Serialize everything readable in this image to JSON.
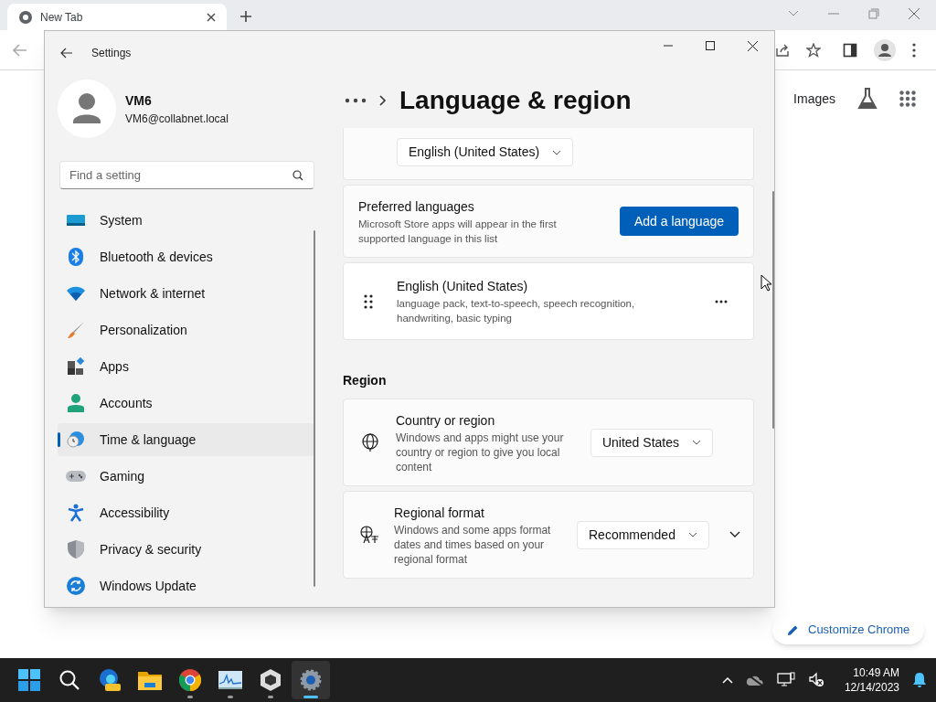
{
  "browser": {
    "tab": {
      "title": "New Tab"
    },
    "links": [
      "Images"
    ],
    "customize_button": "Customize Chrome"
  },
  "settings": {
    "title": "Settings",
    "user": {
      "name": "VM6",
      "email": "VM6@collabnet.local"
    },
    "search": {
      "placeholder": "Find a setting"
    },
    "nav": [
      {
        "label": "System",
        "selected": false
      },
      {
        "label": "Bluetooth & devices",
        "selected": false
      },
      {
        "label": "Network & internet",
        "selected": false
      },
      {
        "label": "Personalization",
        "selected": false
      },
      {
        "label": "Apps",
        "selected": false
      },
      {
        "label": "Accounts",
        "selected": false
      },
      {
        "label": "Time & language",
        "selected": true
      },
      {
        "label": "Gaming",
        "selected": false
      },
      {
        "label": "Accessibility",
        "selected": false
      },
      {
        "label": "Privacy & security",
        "selected": false
      },
      {
        "label": "Windows Update",
        "selected": false
      }
    ],
    "page_title": "Language & region",
    "display_language": "English (United States)",
    "preferred_languages": {
      "title": "Preferred languages",
      "description": "Microsoft Store apps will appear in the first supported language in this list",
      "button": "Add a language"
    },
    "languages": [
      {
        "name": "English (United States)",
        "features": "language pack, text-to-speech, speech recognition, handwriting, basic typing"
      }
    ],
    "region": {
      "heading": "Region",
      "settings": [
        {
          "kind": "globe",
          "title": "Country or region",
          "description": "Windows and apps might use your country or region to give you local content",
          "value": "United States",
          "expandable": false
        },
        {
          "kind": "format",
          "title": "Regional format",
          "description": "Windows and some apps format dates and times based on your regional format",
          "value": "Recommended",
          "expandable": true
        }
      ]
    }
  },
  "taskbar": {
    "apps": [
      {
        "running": false,
        "active": false
      },
      {
        "running": false,
        "active": false
      },
      {
        "running": false,
        "active": false
      },
      {
        "running": false,
        "active": false
      },
      {
        "running": true,
        "active": false
      },
      {
        "running": true,
        "active": false
      },
      {
        "running": true,
        "active": false
      },
      {
        "running": true,
        "active": true
      }
    ],
    "time": "10:49 AM",
    "date": "12/14/2023"
  }
}
